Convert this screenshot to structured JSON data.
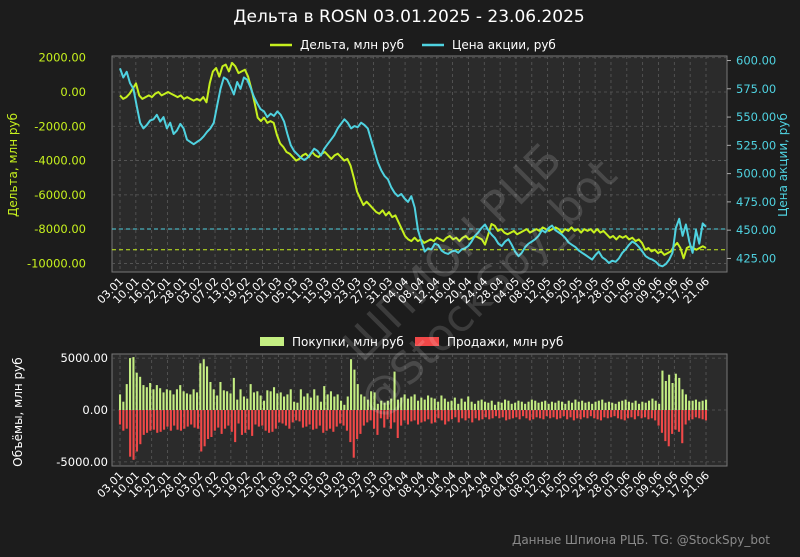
{
  "colors": {
    "background": "#1c1c1c",
    "plot_bg": "#2b2b2b",
    "delta": "#c6f01e",
    "price": "#4fd2e0",
    "buys": "#c4ee82",
    "sells": "#f04848",
    "grid": "#5a5a5a"
  },
  "footer": "Данные Шпиона РЦБ. TG: @StockSpy_bot",
  "watermark": {
    "line1": "ШПИОН РЦБ",
    "line2": "@StockSpy_bot"
  },
  "chart_data": [
    {
      "type": "line",
      "title": "Дельта в ROSN 03.01.2025 - 23.06.2025",
      "ylabel": "Дельта, млн руб",
      "y2label": "Цена акции, руб",
      "ylim": [
        -10500,
        2100
      ],
      "y2lim": [
        413,
        604
      ],
      "yticks": [
        "2000.00",
        "0.00",
        "-2000.00",
        "-4000.00",
        "-6000.00",
        "-8000.00",
        "-10000.00"
      ],
      "y2ticks": [
        "600.00",
        "575.00",
        "550.00",
        "525.00",
        "500.00",
        "475.00",
        "450.00",
        "425.00"
      ],
      "xticks": [
        "03.01",
        "10.01",
        "16.01",
        "22.01",
        "28.01",
        "03.02",
        "07.02",
        "13.02",
        "19.02",
        "25.02",
        "01.03",
        "05.03",
        "11.03",
        "15.03",
        "19.03",
        "23.03",
        "27.03",
        "31.03",
        "04.04",
        "08.04",
        "12.04",
        "16.04",
        "20.04",
        "24.04",
        "28.04",
        "04.05",
        "08.05",
        "12.05",
        "16.05",
        "20.05",
        "24.05",
        "28.05",
        "01.06",
        "05.06",
        "09.06",
        "13.06",
        "17.06",
        "21.06"
      ],
      "grid": true,
      "legend": "top-center",
      "hlines": [
        {
          "axis": "y",
          "value": -9200,
          "color": "#c6f01e"
        },
        {
          "axis": "y2",
          "value": 451,
          "color": "#4fd2e0"
        }
      ],
      "series": [
        {
          "name": "Дельта, млн руб",
          "axis": "y",
          "color": "#c6f01e",
          "values": [
            -200,
            -400,
            -300,
            -100,
            200,
            500,
            -200,
            -400,
            -300,
            -200,
            -300,
            -100,
            0,
            -200,
            -100,
            0,
            -100,
            -200,
            -300,
            -200,
            -400,
            -300,
            -400,
            -500,
            -400,
            -500,
            -300,
            -600,
            500,
            1200,
            1400,
            900,
            1500,
            1600,
            1200,
            1700,
            1500,
            1100,
            1200,
            1300,
            900,
            200,
            -600,
            -1500,
            -1700,
            -1500,
            -1800,
            -1700,
            -1800,
            -2500,
            -3000,
            -3200,
            -3500,
            -3600,
            -3800,
            -4000,
            -3900,
            -3700,
            -3600,
            -3800,
            -3500,
            -3700,
            -3800,
            -3600,
            -3500,
            -3700,
            -3900,
            -3700,
            -3600,
            -3800,
            -4000,
            -3900,
            -4300,
            -5000,
            -5800,
            -6200,
            -6600,
            -6400,
            -6600,
            -6800,
            -7000,
            -7100,
            -6900,
            -7200,
            -7000,
            -7300,
            -7200,
            -7600,
            -8000,
            -8400,
            -8600,
            -8700,
            -8500,
            -8700,
            -8600,
            -8800,
            -8700,
            -8600,
            -8700,
            -8500,
            -8600,
            -8700,
            -8500,
            -8400,
            -8600,
            -8500,
            -8700,
            -8500,
            -8400,
            -8600,
            -8500,
            -8400,
            -8500,
            -8600,
            -8900,
            -8300,
            -7700,
            -7800,
            -8100,
            -8000,
            -8200,
            -8300,
            -8200,
            -8100,
            -8300,
            -8200,
            -8100,
            -8000,
            -8200,
            -8100,
            -8000,
            -8100,
            -7900,
            -8000,
            -8100,
            -8000,
            -7900,
            -8000,
            -8200,
            -8000,
            -8100,
            -7900,
            -8100,
            -8000,
            -8200,
            -8000,
            -8100,
            -8000,
            -8200,
            -8000,
            -8200,
            -8100,
            -8300,
            -8500,
            -8400,
            -8600,
            -8400,
            -8500,
            -8400,
            -8600,
            -8500,
            -8700,
            -8600,
            -8800,
            -9200,
            -9100,
            -9300,
            -9200,
            -9400,
            -9300,
            -9500,
            -9400,
            -9300,
            -9000,
            -8800,
            -9100,
            -9700,
            -9100,
            -9000,
            -9100,
            -9200,
            -9100,
            -9000,
            -9100
          ]
        },
        {
          "name": "Цена акции, руб",
          "axis": "y2",
          "color": "#4fd2e0",
          "values": [
            593,
            585,
            590,
            580,
            575,
            560,
            545,
            540,
            543,
            547,
            548,
            552,
            546,
            550,
            540,
            545,
            535,
            538,
            544,
            540,
            530,
            528,
            526,
            528,
            530,
            533,
            537,
            540,
            545,
            560,
            575,
            585,
            583,
            577,
            570,
            581,
            575,
            585,
            583,
            576,
            568,
            562,
            557,
            555,
            550,
            553,
            551,
            555,
            552,
            546,
            535,
            525,
            520,
            517,
            514,
            512,
            514,
            518,
            522,
            520,
            516,
            522,
            526,
            530,
            534,
            540,
            544,
            548,
            545,
            540,
            542,
            541,
            545,
            543,
            540,
            530,
            520,
            510,
            503,
            498,
            495,
            488,
            483,
            480,
            482,
            478,
            475,
            480,
            470,
            450,
            440,
            431,
            434,
            433,
            438,
            437,
            432,
            430,
            429,
            431,
            432,
            430,
            433,
            434,
            436,
            440,
            445,
            448,
            452,
            455,
            450,
            446,
            443,
            438,
            436,
            440,
            442,
            437,
            431,
            427,
            430,
            435,
            438,
            440,
            442,
            445,
            450,
            448,
            452,
            454,
            450,
            448,
            446,
            443,
            439,
            437,
            435,
            432,
            430,
            428,
            426,
            424,
            428,
            431,
            426,
            424,
            421,
            423,
            422,
            425,
            430,
            433,
            437,
            440,
            438,
            435,
            431,
            427,
            425,
            424,
            422,
            419,
            418,
            420,
            424,
            430,
            452,
            460,
            445,
            455,
            440,
            430,
            450,
            438,
            456,
            453
          ]
        }
      ]
    },
    {
      "type": "bar",
      "ylabel": "Объёмы, млн руб",
      "ylim": [
        -5400,
        5400
      ],
      "yticks": [
        "5000.00",
        "0.00",
        "-5000.00"
      ],
      "xticks": [
        "03.01",
        "10.01",
        "16.01",
        "22.01",
        "28.01",
        "03.02",
        "07.02",
        "13.02",
        "19.02",
        "25.02",
        "01.03",
        "05.03",
        "11.03",
        "15.03",
        "19.03",
        "23.03",
        "27.03",
        "31.03",
        "04.04",
        "08.04",
        "12.04",
        "16.04",
        "20.04",
        "24.04",
        "28.04",
        "04.05",
        "08.05",
        "12.05",
        "16.05",
        "20.05",
        "24.05",
        "28.05",
        "01.06",
        "05.06",
        "09.06",
        "13.06",
        "17.06",
        "21.06"
      ],
      "grid": true,
      "legend": "top-center",
      "series": [
        {
          "name": "Покупки, млн руб",
          "color": "#c4ee82",
          "values": [
            1500,
            800,
            2500,
            5000,
            5100,
            3600,
            3200,
            2400,
            2200,
            2600,
            2000,
            2400,
            2100,
            1700,
            2000,
            1900,
            1500,
            2000,
            2400,
            1800,
            1600,
            1500,
            2000,
            1700,
            4500,
            4900,
            4200,
            2700,
            2000,
            1400,
            2700,
            1900,
            1800,
            1600,
            3100,
            1000,
            2000,
            1300,
            1100,
            2500,
            1700,
            1800,
            1400,
            900,
            1900,
            1800,
            2200,
            1600,
            1700,
            1300,
            1500,
            2000,
            800,
            700,
            2000,
            1300,
            1600,
            1200,
            2000,
            1400,
            800,
            2300,
            1500,
            1800,
            1300,
            1500,
            900,
            500,
            1300,
            4900,
            3900,
            2500,
            1500,
            1300,
            1000,
            1800,
            1700,
            600,
            900,
            700,
            900,
            1100,
            3700,
            1000,
            1200,
            1500,
            1100,
            1300,
            1500,
            900,
            1200,
            1000,
            1400,
            1200,
            1100,
            800,
            1400,
            1100,
            800,
            900,
            1200,
            600,
            1100,
            800,
            1300,
            800,
            600,
            900,
            1000,
            800,
            700,
            900,
            500,
            800,
            700,
            1000,
            900,
            600,
            700,
            900,
            800,
            600,
            800,
            1000,
            900,
            700,
            800,
            900,
            600,
            800,
            700,
            900,
            800,
            600,
            900,
            700,
            1000,
            800,
            900,
            700,
            800,
            600,
            800,
            900,
            1000,
            700,
            800,
            700,
            600,
            800,
            900,
            1000,
            800,
            700,
            900,
            600,
            800,
            700,
            900,
            1100,
            900,
            600,
            3800,
            2800,
            3400,
            2600,
            3500,
            3100,
            2000,
            1500,
            900,
            900,
            1000,
            800,
            900,
            1000
          ]
        },
        {
          "name": "Продажи, млн руб",
          "color": "#f04848",
          "values": [
            -1400,
            -2000,
            -1800,
            -4500,
            -4800,
            -4000,
            -3300,
            -2400,
            -2200,
            -2000,
            -1900,
            -2200,
            -2100,
            -1900,
            -1600,
            -2000,
            -1500,
            -1900,
            -2000,
            -1800,
            -1600,
            -1400,
            -1700,
            -1800,
            -4000,
            -3500,
            -2800,
            -2600,
            -2000,
            -1700,
            -2300,
            -1800,
            -1500,
            -2100,
            -3100,
            -1300,
            -2400,
            -2200,
            -1900,
            -2500,
            -1400,
            -1600,
            -1500,
            -2000,
            -2200,
            -2100,
            -1800,
            -1200,
            -1300,
            -1500,
            -1800,
            -1200,
            -1000,
            -1100,
            -1700,
            -1600,
            -1400,
            -1900,
            -1800,
            -1500,
            -2200,
            -2000,
            -1800,
            -2100,
            -1600,
            -1300,
            -1500,
            -2000,
            -3100,
            -4600,
            -2800,
            -2300,
            -1500,
            -1200,
            -1000,
            -1800,
            -2400,
            -800,
            -1700,
            -900,
            -1800,
            -1200,
            -2700,
            -1500,
            -1000,
            -1400,
            -1100,
            -1000,
            -1400,
            -1200,
            -1100,
            -900,
            -1300,
            -1200,
            -800,
            -1000,
            -1400,
            -1100,
            -900,
            -700,
            -1200,
            -800,
            -1000,
            -800,
            -1200,
            -800,
            -1000,
            -900,
            -700,
            -900,
            -800,
            -600,
            -800,
            -700,
            -1000,
            -900,
            -800,
            -700,
            -900,
            -600,
            -800,
            -1000,
            -900,
            -700,
            -800,
            -900,
            -600,
            -800,
            -700,
            -900,
            -800,
            -600,
            -900,
            -700,
            -1000,
            -800,
            -900,
            -700,
            -800,
            -600,
            -800,
            -900,
            -1000,
            -700,
            -800,
            -700,
            -600,
            -800,
            -900,
            -1000,
            -800,
            -700,
            -900,
            -600,
            -800,
            -700,
            -900,
            -800,
            -1000,
            -1500,
            -2200,
            -3000,
            -3500,
            -2300,
            -1900,
            -2100,
            -3200,
            -1400,
            -1000,
            -900,
            -700,
            -800,
            -900,
            -1000
          ]
        }
      ]
    }
  ]
}
